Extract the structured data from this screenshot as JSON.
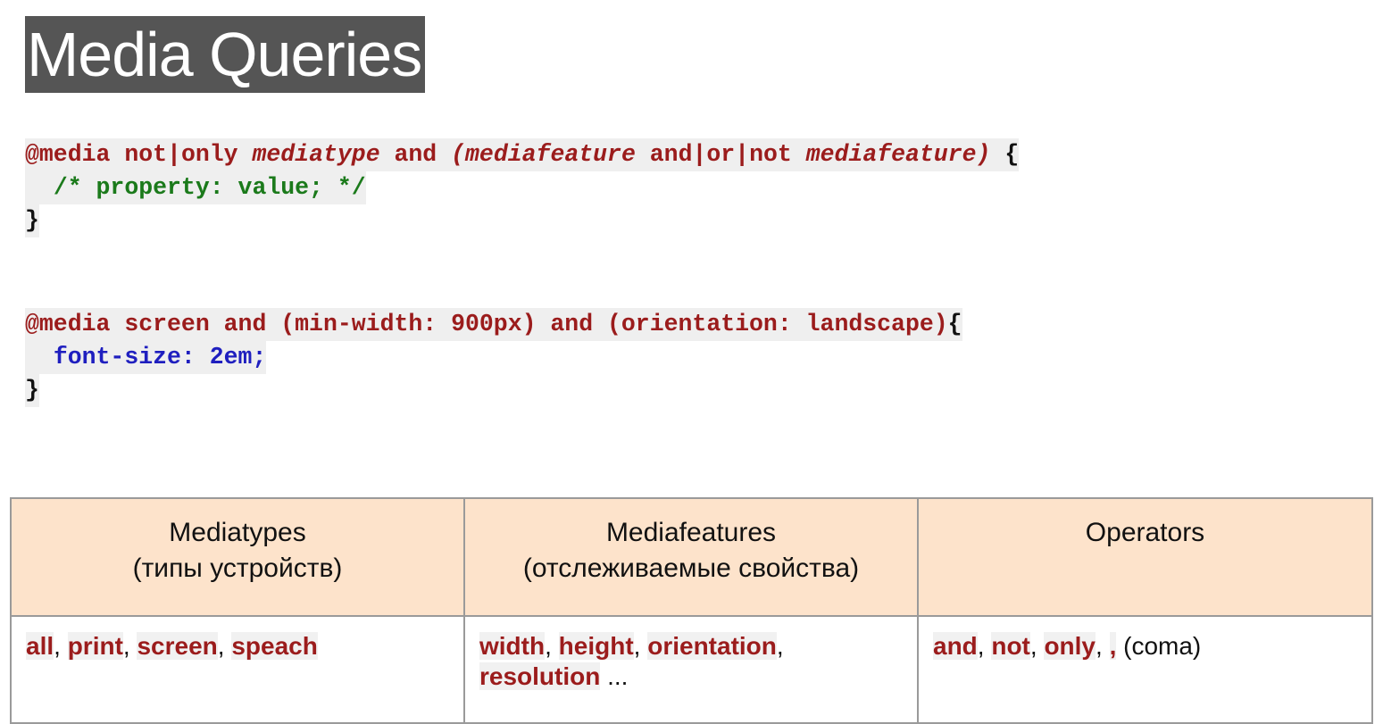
{
  "title": "Media Queries",
  "code_block_1": {
    "line1": {
      "at": "@media",
      "kw1": "not|only",
      "it1": "mediatype",
      "kw2": "and",
      "it2": "(mediafeature",
      "kw3": "and|or|not",
      "it3": "mediafeature)",
      "brace": "{"
    },
    "line2": "/* property: value; */",
    "line3": "}"
  },
  "code_block_2": {
    "line1": "@media screen and (min-width: 900px) and (orientation: landscape)",
    "brace": "{",
    "line2": "font-size: 2em;",
    "line3": "}"
  },
  "table": {
    "headers": [
      {
        "title": "Mediatypes",
        "subtitle": "(типы устройств)"
      },
      {
        "title": "Mediafeatures",
        "subtitle": "(отслеживаемые свойства)"
      },
      {
        "title": "Operators",
        "subtitle": ""
      }
    ],
    "mediatypes": [
      "all",
      "print",
      "screen",
      "speach"
    ],
    "mediafeatures": [
      "width",
      "height",
      "orientation",
      "resolution"
    ],
    "mediafeatures_suffix": "...",
    "operators": [
      "and",
      "not",
      "only",
      ","
    ],
    "operators_suffix": "(coma)",
    "separator": ","
  },
  "colors": {
    "title_bg": "#555555",
    "keyword": "#9b1c1c",
    "comment": "#1b7a1b",
    "property": "#1f1fbf",
    "header_bg": "#fde3cb"
  }
}
